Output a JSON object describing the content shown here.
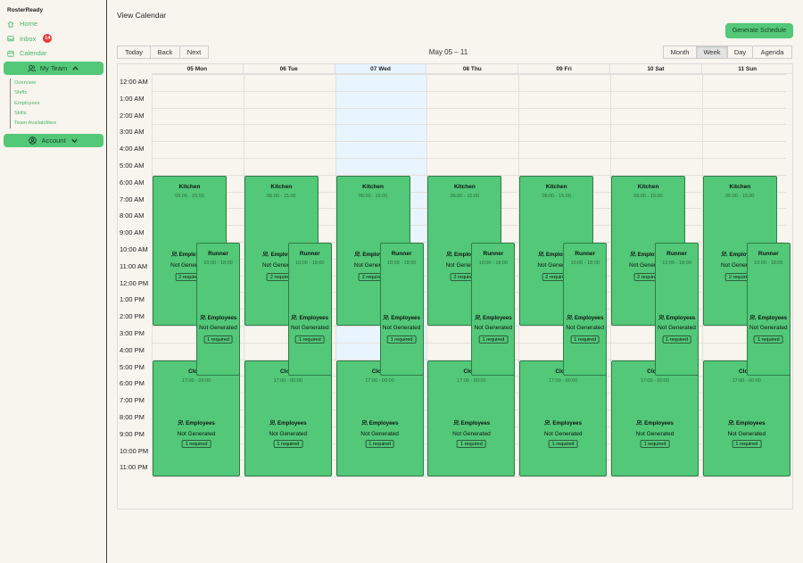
{
  "app": {
    "title": "RosterReady"
  },
  "nav": {
    "home": "Home",
    "inbox": "Inbox",
    "inbox_badge": "14",
    "calendar": "Calendar",
    "my_team": "My Team",
    "subnav": [
      "Overview",
      "Shifts",
      "Employees",
      "Skills",
      "Team Availabilities"
    ],
    "account": "Account"
  },
  "header": {
    "title": "View Calendar",
    "generate_button": "Generate Schedule"
  },
  "toolbar": {
    "today": "Today",
    "back": "Back",
    "next": "Next",
    "range": "May 05 – 11",
    "views": [
      "Month",
      "Week",
      "Day",
      "Agenda"
    ],
    "active_view": "Week"
  },
  "calendar": {
    "days": [
      "05 Mon",
      "06 Tue",
      "07 Wed",
      "08 Thu",
      "09 Fri",
      "10 Sat",
      "11 Sun"
    ],
    "highlighted_day": "07 Wed",
    "hours": [
      "12:00 AM",
      "1:00 AM",
      "2:00 AM",
      "3:00 AM",
      "4:00 AM",
      "5:00 AM",
      "6:00 AM",
      "7:00 AM",
      "8:00 AM",
      "9:00 AM",
      "10:00 AM",
      "11:00 AM",
      "12:00 PM",
      "1:00 PM",
      "2:00 PM",
      "3:00 PM",
      "4:00 PM",
      "5:00 PM",
      "6:00 PM",
      "7:00 PM",
      "8:00 PM",
      "9:00 PM",
      "10:00 PM",
      "11:00 PM"
    ],
    "shifts": [
      {
        "name": "Kitchen",
        "time": "06:00 - 15:00",
        "employees_label": "Employees",
        "status": "Not Generated",
        "required": "2 required"
      },
      {
        "name": "Runner",
        "time": "10:00 - 18:00",
        "employees_label": "Employees",
        "status": "Not Generated",
        "required": "1 required"
      },
      {
        "name": "Close",
        "time": "17:00 - 00:00",
        "employees_label": "Employees",
        "status": "Not Generated",
        "required": "1 required"
      }
    ]
  },
  "colors": {
    "accent": "#52c878",
    "badge": "#e53935",
    "today": "#e8f4ff"
  }
}
